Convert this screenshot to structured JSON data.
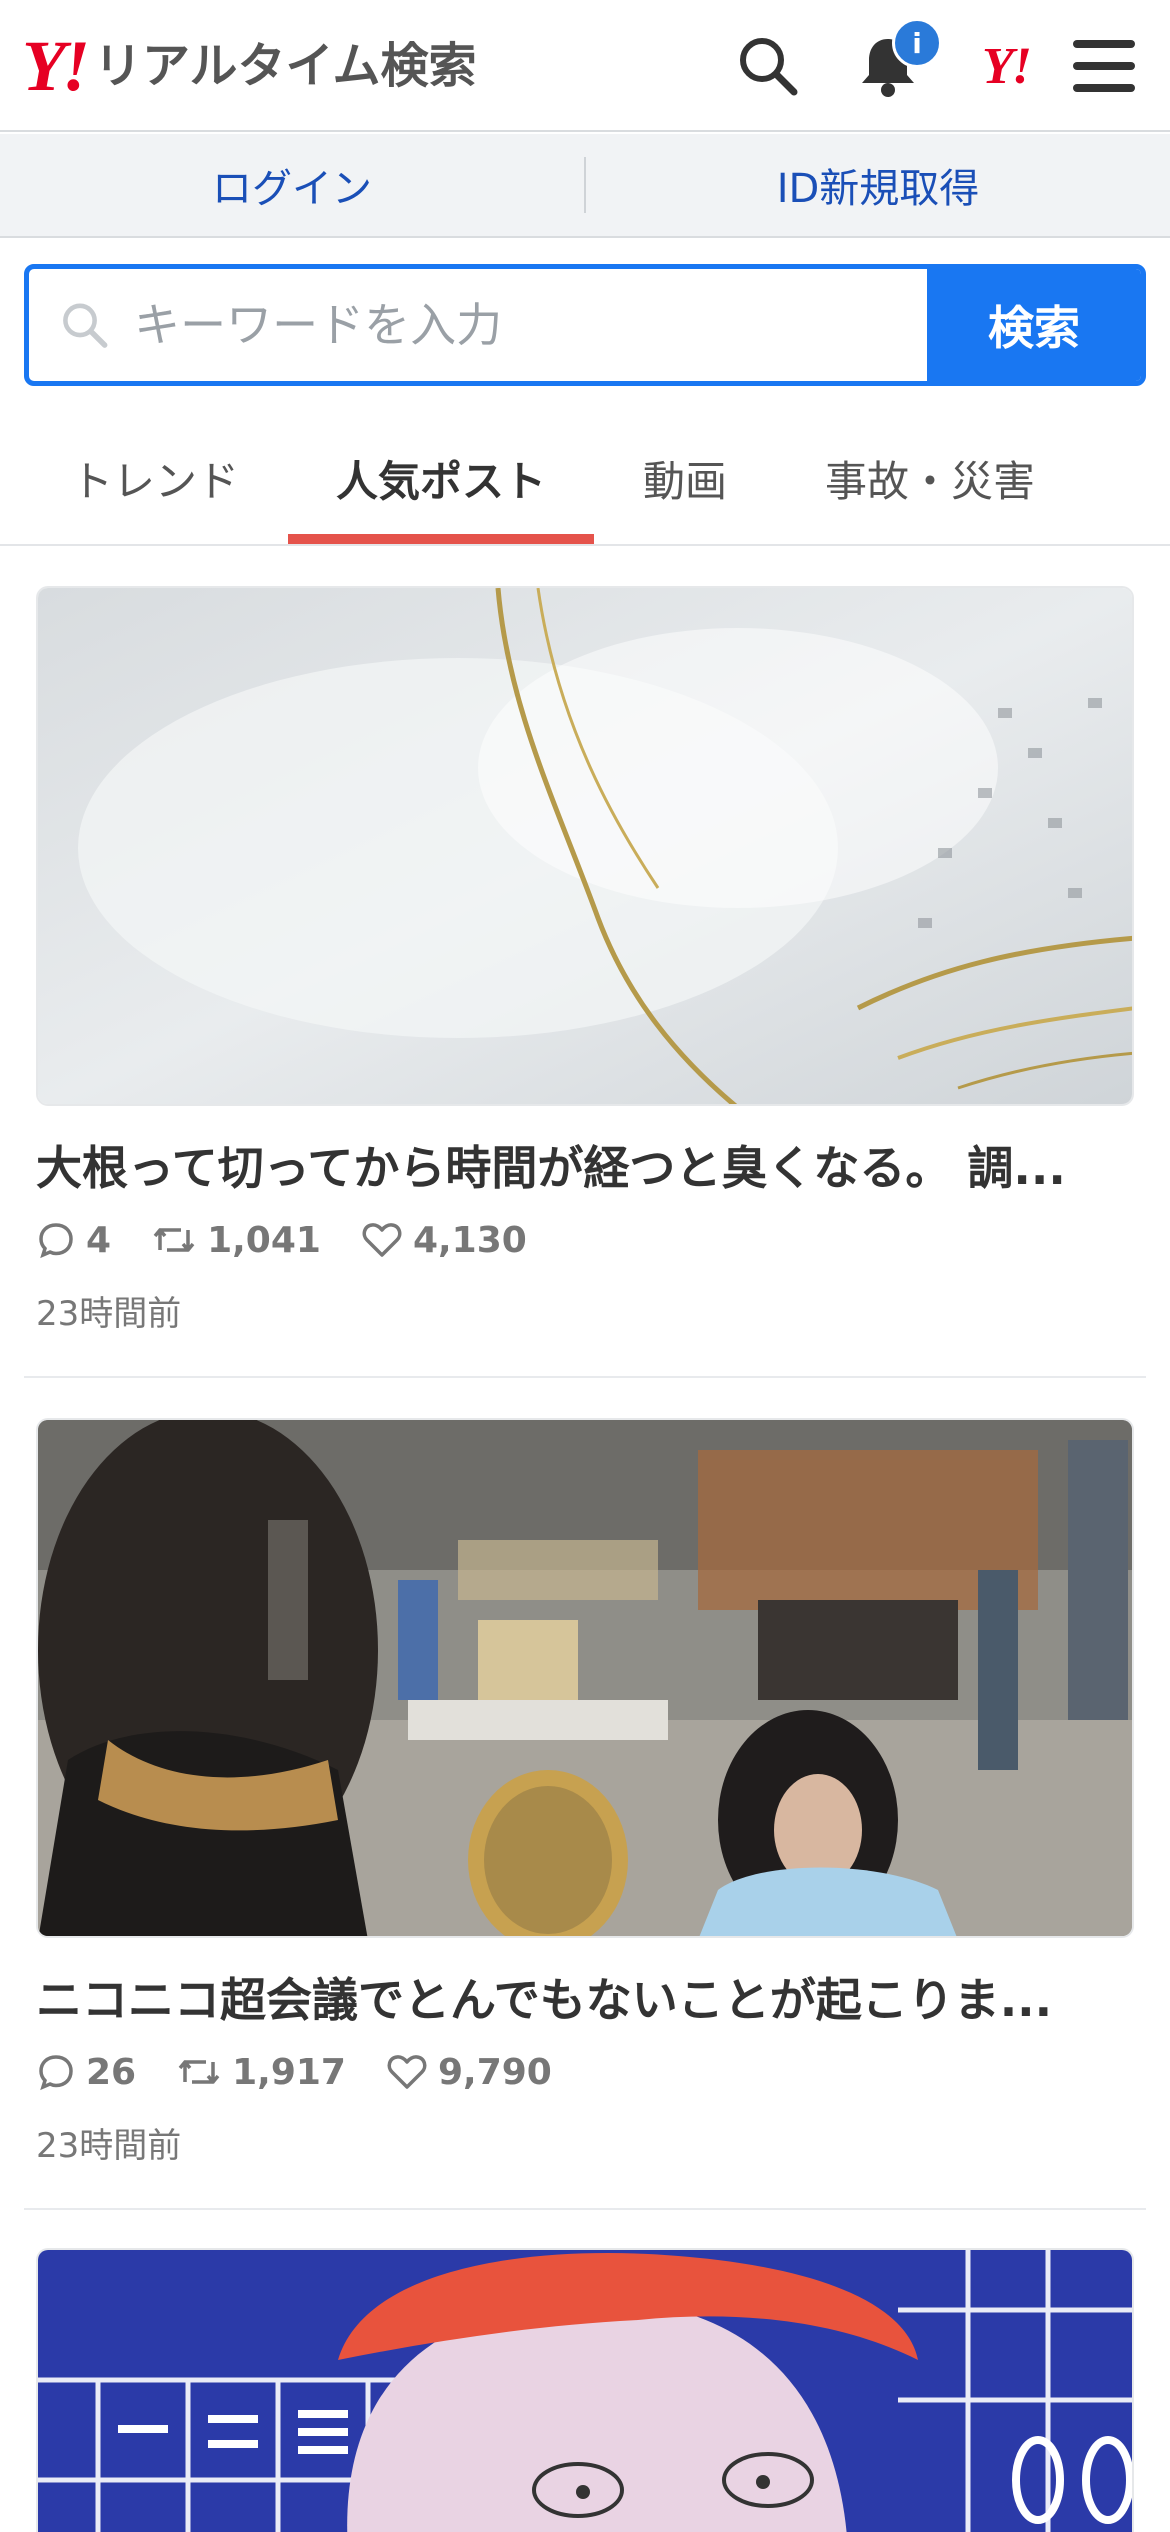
{
  "header": {
    "logo_mark": "Y!",
    "logo_text": "リアルタイム検索",
    "notification_badge": "i",
    "yahoo_mark": "Y!"
  },
  "account": {
    "login_label": "ログイン",
    "register_label": "ID新規取得"
  },
  "search": {
    "placeholder": "キーワードを入力",
    "button_label": "検索"
  },
  "tabs": [
    {
      "label": "トレンド",
      "active": false
    },
    {
      "label": "人気ポスト",
      "active": true
    },
    {
      "label": "動画",
      "active": false
    },
    {
      "label": "事故・災害",
      "active": false
    }
  ],
  "posts": [
    {
      "title": "大根って切ってから時間が経つと臭くなる。 調...",
      "replies": "4",
      "reposts": "1,041",
      "likes": "4,130",
      "time": "23時間前"
    },
    {
      "title": "ニコニコ超会議でとんでもないことが起こりま...",
      "replies": "26",
      "reposts": "1,917",
      "likes": "9,790",
      "time": "23時間前"
    },
    {
      "title": "",
      "replies": "",
      "reposts": "",
      "likes": "",
      "time": ""
    }
  ],
  "colors": {
    "accent": "#1977f2",
    "brand_red": "#e60023",
    "tab_underline": "#e5534b",
    "link_blue": "#1a4fb7"
  }
}
